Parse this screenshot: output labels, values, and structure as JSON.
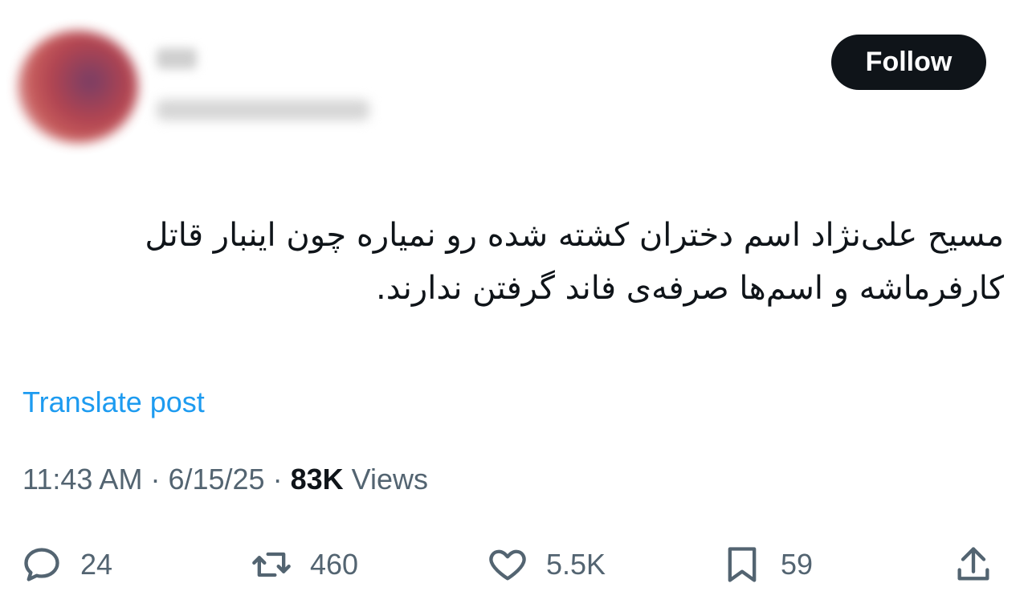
{
  "author": {
    "display_name": "",
    "handle": ""
  },
  "follow_label": "Follow",
  "post": {
    "text": "مسیح علی‌نژاد اسم دختران کشته شده رو نمیاره چون اینبار قاتل کارفرماشه و اسم‌ها صرفه‌ی فاند گرفتن ندارند."
  },
  "translate_label": "Translate post",
  "meta": {
    "time": "11:43 AM",
    "sep1": " · ",
    "date": "6/15/25",
    "sep2": " · ",
    "views_count": "83K",
    "views_label": " Views"
  },
  "actions": {
    "replies": "24",
    "reposts": "460",
    "likes": "5.5K",
    "bookmarks": "59"
  },
  "icons": {
    "reply": "reply-icon",
    "repost": "repost-icon",
    "like": "heart-icon",
    "bookmark": "bookmark-icon",
    "share": "share-icon"
  },
  "colors": {
    "link": "#1d9bf0",
    "muted": "#536471",
    "text": "#0f1419",
    "button_bg": "#0f1419"
  }
}
